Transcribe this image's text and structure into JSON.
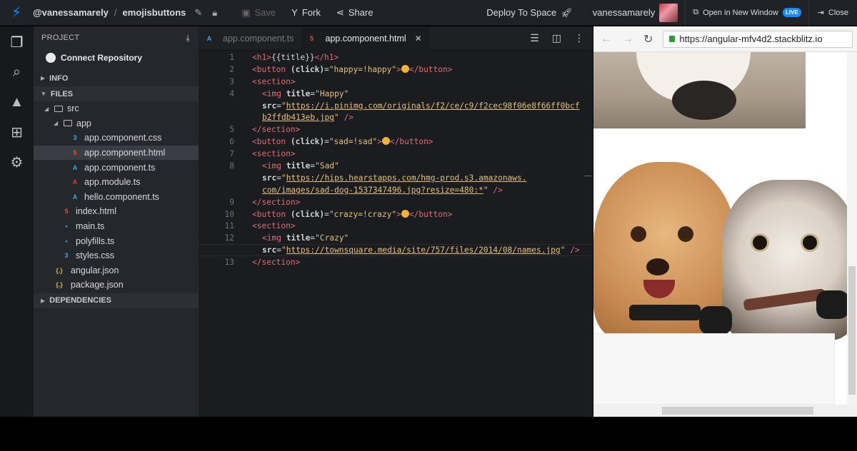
{
  "topbar": {
    "username": "@vanessamarely",
    "separator": "/",
    "project": "emojisbuttons",
    "save_label": "Save",
    "fork_label": "Fork",
    "share_label": "Share",
    "deploy_label": "Deploy To Space",
    "user_name": "vanessamarely",
    "open_window_label": "Open in New Window",
    "live_badge": "LIVE",
    "close_label": "Close"
  },
  "sidebar": {
    "header": "PROJECT",
    "connect_repo": "Connect Repository",
    "sections": {
      "info": "INFO",
      "files": "FILES",
      "dependencies": "DEPENDENCIES"
    },
    "tree": [
      {
        "label": "src",
        "type": "folder"
      },
      {
        "label": "app",
        "type": "folder"
      },
      {
        "label": "app.component.css",
        "type": "css"
      },
      {
        "label": "app.component.html",
        "type": "html",
        "selected": true
      },
      {
        "label": "app.component.ts",
        "type": "ang"
      },
      {
        "label": "app.module.ts",
        "type": "ang"
      },
      {
        "label": "hello.component.ts",
        "type": "ang"
      },
      {
        "label": "index.html",
        "type": "html"
      },
      {
        "label": "main.ts",
        "type": "ts"
      },
      {
        "label": "polyfills.ts",
        "type": "ts"
      },
      {
        "label": "styles.css",
        "type": "css"
      },
      {
        "label": "angular.json",
        "type": "json"
      },
      {
        "label": "package.json",
        "type": "json"
      }
    ]
  },
  "tabs": [
    {
      "label": "app.component.ts",
      "active": false
    },
    {
      "label": "app.component.html",
      "active": true
    }
  ],
  "editor": {
    "line_numbers": [
      "1",
      "2",
      "3",
      "4",
      "",
      "5",
      "6",
      "7",
      "8",
      "",
      "9",
      "10",
      "11",
      "12",
      "",
      "13"
    ],
    "lines": [
      "<h1>{{title}}</h1>",
      "<button (click)=\"happy=!happy\">😀</button>",
      "<section>",
      "  <img title=\"Happy\"",
      "  src=\"https://i.pinimg.com/originals/f2/ce/c9/f2cec98f06e8f66ff0bcf",
      "  b2ffdb413eb.jpg\" />",
      "</section>",
      "<button (click)=\"sad=!sad\">😢</button>",
      "<section>",
      "  <img title=\"Sad\"",
      "  src=\"https://hips.hearstapps.com/hmg-prod.s3.amazonaws.",
      "  com/images/sad-dog-1537347496.jpg?resize=480:*\" />",
      "</section>",
      "<button (click)=\"crazy=!crazy\">🤪</button>",
      "<section>",
      "  <img title=\"Crazy\"",
      "  src=\"https://townsquare.media/site/757/files/2014/08/names.jpg\" />",
      "</section>"
    ]
  },
  "preview": {
    "url": "https://angular-mfv4d2.stackblitz.io"
  },
  "icons": [
    "bolt-icon",
    "pencil-icon",
    "lock-icon",
    "save-icon",
    "fork-icon",
    "share-icon",
    "rocket-icon",
    "open-window-icon",
    "close-icon",
    "files-icon",
    "search-icon",
    "firebase-icon",
    "extensions-icon",
    "gear-icon",
    "download-icon",
    "github-icon"
  ]
}
